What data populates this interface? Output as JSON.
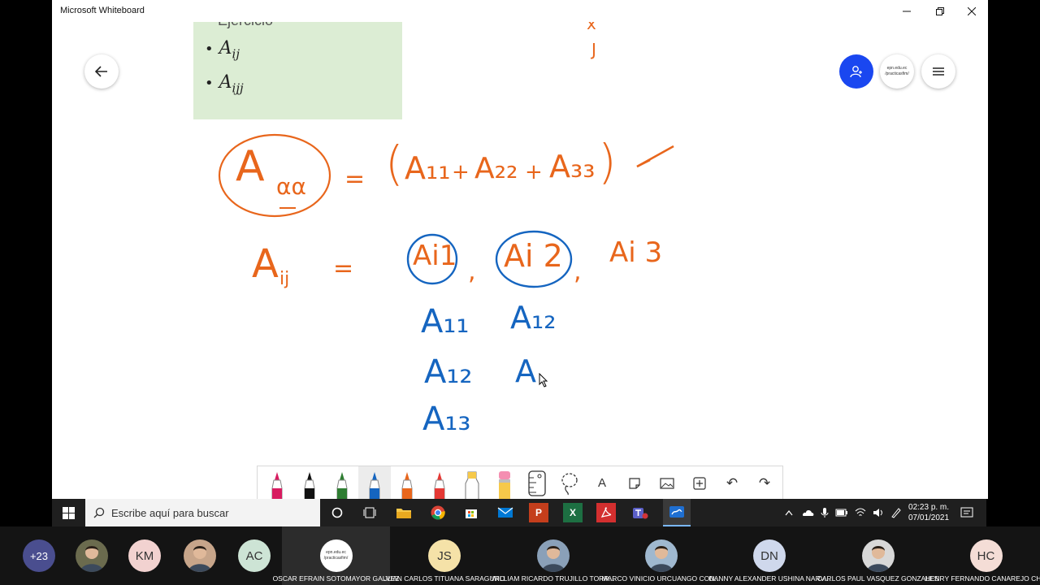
{
  "window": {
    "title": "Microsoft Whiteboard"
  },
  "note": {
    "cut_text": "Ejercicio",
    "items": [
      {
        "bullet": "•",
        "base": "A",
        "sub": "ij"
      },
      {
        "bullet": "•",
        "base": "A",
        "sub": "ijj"
      }
    ]
  },
  "top_right_buttons": {
    "site_text_1": "epn.edu.ec",
    "site_text_2": "/practicasfim/"
  },
  "ink": {
    "orange": {
      "lhs_base": "A",
      "lhs_sub": "αα",
      "equals_1": "=",
      "paren_open": "(",
      "term1": "A₁₁",
      "plus_1": "+",
      "term2": "A₂₂",
      "plus_2": "+",
      "term3": "A₃₃",
      "paren_close": ")",
      "check": "✓",
      "aij_base": "A",
      "aij_sub": "ij",
      "equals_2": "=",
      "ai1": "Ai1",
      "comma_1": ",",
      "ai2": "Ai 2",
      "comma_2": ",",
      "ai3": "Ai 3",
      "top_cut_1": "x",
      "top_cut_2": "J"
    },
    "blue": {
      "a11": "A₁₁",
      "a12_left": "A₁₂",
      "a13": "A₁₃",
      "a12_right": "A₁₂",
      "a_partial": "A"
    }
  },
  "toolbar": {
    "pens": [
      {
        "name": "pen-magenta",
        "color": "#d81b60"
      },
      {
        "name": "pen-black",
        "color": "#111111"
      },
      {
        "name": "pen-green",
        "color": "#2e7d32"
      },
      {
        "name": "pen-blue",
        "color": "#1565c0"
      },
      {
        "name": "pen-orange",
        "color": "#e8661c"
      },
      {
        "name": "pen-red",
        "color": "#e53935"
      },
      {
        "name": "highlighter-yellow",
        "color": "#f6c94a"
      }
    ],
    "eraser_color": "#f48fb1",
    "text_tool_glyph": "A",
    "undo_glyph": "↶",
    "redo_glyph": "↷",
    "add_glyph": "+"
  },
  "taskbar": {
    "search_placeholder": "Escribe aquí para buscar",
    "time": "02:23 p. m.",
    "date": "07/01/2021",
    "app_labels": [
      "P",
      "X"
    ]
  },
  "participants": {
    "overflow": "+23",
    "tiles": [
      {
        "initials": "",
        "name": "",
        "avatar_color": "#6b6b4e"
      },
      {
        "initials": "KM",
        "name": "",
        "avatar_color": "#f2d2d0"
      },
      {
        "initials": "",
        "name": "",
        "avatar_color": "#c7a58a"
      },
      {
        "initials": "AC",
        "name": "",
        "avatar_color": "#cde4d5"
      },
      {
        "initials": "",
        "name": "OSCAR EFRAIN SOTOMAYOR GALVEZ",
        "avatar_color": "#ffffff",
        "site_1": "epn.edu.ec",
        "site_2": "/practicasfim/"
      },
      {
        "initials": "JS",
        "name": "JUAN CARLOS TITUANA SARAGURO",
        "avatar_color": "#f5e2a8"
      },
      {
        "initials": "",
        "name": "WILLIAM RICARDO TRUJILLO TORR...",
        "avatar_color": "#8aa0b8"
      },
      {
        "initials": "",
        "name": "MARCO VINICIO URCUANGO CON...",
        "avatar_color": "#9fb8cf"
      },
      {
        "initials": "DN",
        "name": "DANNY ALEXANDER USHINA NARV...",
        "avatar_color": "#cfd8ec"
      },
      {
        "initials": "",
        "name": "CARLOS PAUL VASQUEZ GONZALES",
        "avatar_color": "#d8d8d8"
      },
      {
        "initials": "HC",
        "name": "HENRY FERNANDO CANAREJO CH...",
        "avatar_color": "#f4ddd6"
      }
    ]
  }
}
